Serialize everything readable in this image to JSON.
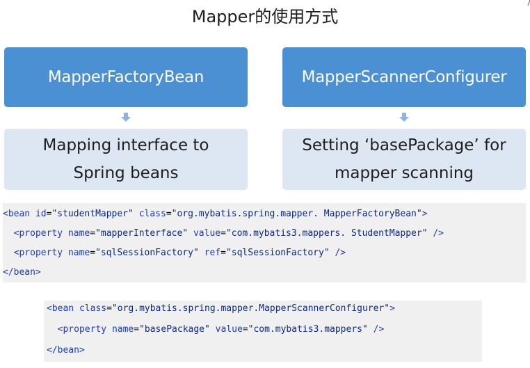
{
  "title": "Mapper的使用方式",
  "left_card": {
    "header": "MapperFactoryBean",
    "body_line1": "Mapping interface to",
    "body_line2": "Spring beans"
  },
  "right_card": {
    "header": "MapperScannerConfigurer",
    "body_line1": "Setting ‘basePackage’ for",
    "body_line2": "mapper scanning"
  },
  "code1": {
    "lines": [
      "<bean id=\"studentMapper\" class=\"org.mybatis.spring.mapper. MapperFactoryBean\">",
      "  <property name=\"mapperInterface\" value=\"com.mybatis3.mappers. StudentMapper\" />",
      "  <property name=\"sqlSessionFactory\" ref=\"sqlSessionFactory\" />",
      "</bean>"
    ]
  },
  "code2": {
    "lines": [
      "<bean class=\"org.mybatis.spring.mapper.MapperScannerConfigurer\">",
      "  <property name=\"basePackage\" value=\"com.mybatis3.mappers\" />",
      "</bean>"
    ]
  },
  "colors": {
    "header_blue": "#4a90d3",
    "body_light_blue": "#dde6f3",
    "arrow": "#8fb3dc",
    "code_bg": "#f0f0f0",
    "code_keyword": "#1f3da8"
  }
}
